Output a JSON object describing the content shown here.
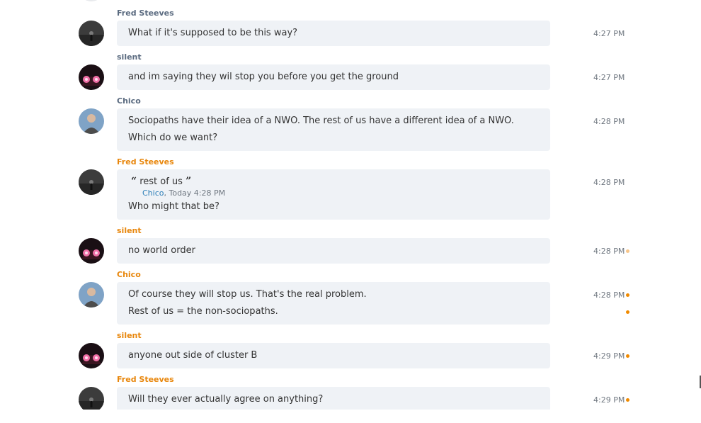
{
  "messages": [
    {
      "author": "Fred Steeves",
      "author_state": "read",
      "avatar": "fred-avatar",
      "lines": [
        "What if it's supposed to be this way?"
      ],
      "time": "4:27 PM"
    },
    {
      "author": "silent",
      "author_state": "read",
      "avatar": "silent-avatar",
      "lines": [
        "and im saying they wil stop you before you get the ground"
      ],
      "time": "4:27 PM"
    },
    {
      "author": "Chico",
      "author_state": "read",
      "avatar": "chico-avatar",
      "lines": [
        "Sociopaths have their idea of a NWO.  The rest of us have a different idea of a NWO.",
        "Which do we want?"
      ],
      "time": "4:28 PM"
    },
    {
      "author": "Fred Steeves",
      "author_state": "unread",
      "avatar": "fred-avatar",
      "quote": {
        "text": "rest of us",
        "author": "Chico",
        "when": ", Today 4:28 PM"
      },
      "lines": [
        "Who might that be?"
      ],
      "time": "4:28 PM"
    },
    {
      "author": "silent",
      "author_state": "unread",
      "avatar": "silent-avatar",
      "lines": [
        "no world order"
      ],
      "time": "4:28 PM"
    },
    {
      "author": "Chico",
      "author_state": "unread",
      "avatar": "chico-avatar",
      "lines": [
        "Of course they will stop us.  That's the real problem.",
        "Rest of us = the non-sociopaths."
      ],
      "time": "4:28 PM"
    },
    {
      "author": "silent",
      "author_state": "unread",
      "avatar": "silent-avatar",
      "lines": [
        "anyone out side of cluster B"
      ],
      "time": "4:29 PM"
    },
    {
      "author": "Fred Steeves",
      "author_state": "unread",
      "avatar": "fred-avatar",
      "lines": [
        "Will they ever actually agree on anything?"
      ],
      "time": "4:29 PM"
    }
  ],
  "colors": {
    "read_author": "#5b6b80",
    "unread_author": "#e8870d",
    "bubble_bg": "#eff2f6",
    "unread_dot": "#f08a00",
    "quote_author": "#2d7fb8"
  }
}
